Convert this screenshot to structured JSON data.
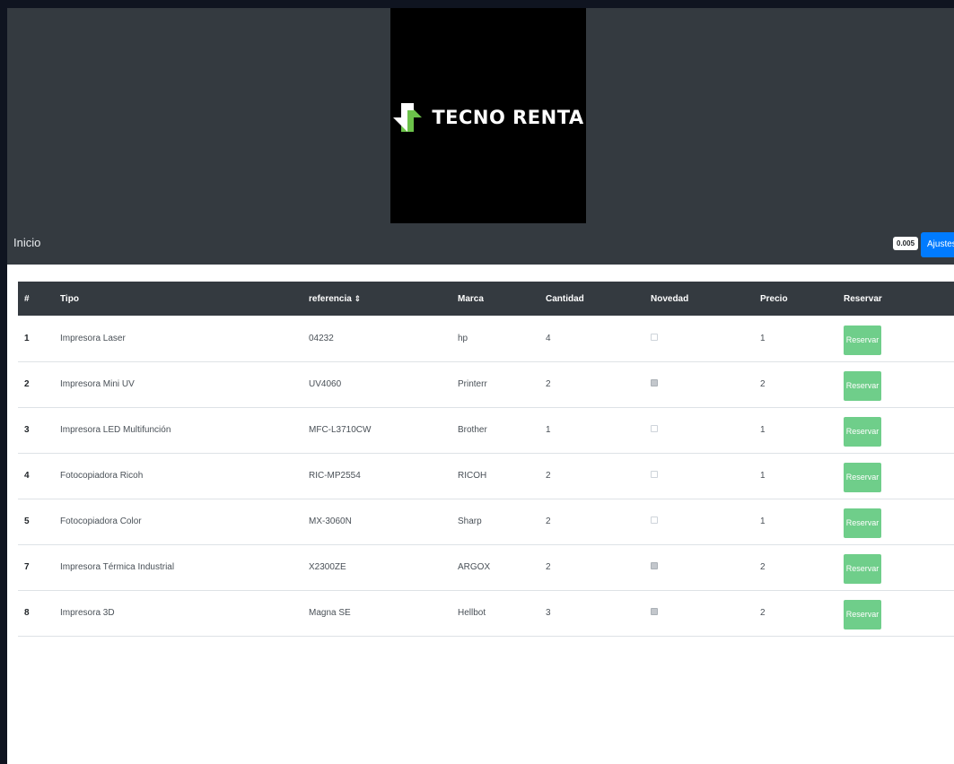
{
  "brand": {
    "name": "TECNO RENTA",
    "logo_icon": "tecno-renta-arrows-icon"
  },
  "nav": {
    "home_label": "Inicio",
    "version": "0.005",
    "settings_label": "Ajustes"
  },
  "table": {
    "columns": [
      "#",
      "Tipo",
      "referencia",
      "Marca",
      "Cantidad",
      "Novedad",
      "Precio",
      "Reservar"
    ],
    "sort_indicator": "⇕",
    "reserve_label": "Reservar",
    "rows": [
      {
        "id": "1",
        "tipo": "Impresora Laser",
        "referencia": "04232",
        "marca": "hp",
        "cantidad": "4",
        "novedad": false,
        "precio": "1"
      },
      {
        "id": "2",
        "tipo": "Impresora Mini UV",
        "referencia": "UV4060",
        "marca": "Printerr",
        "cantidad": "2",
        "novedad": true,
        "precio": "2"
      },
      {
        "id": "3",
        "tipo": "Impresora LED Multifunción",
        "referencia": "MFC-L3710CW",
        "marca": "Brother",
        "cantidad": "1",
        "novedad": false,
        "precio": "1"
      },
      {
        "id": "4",
        "tipo": "Fotocopiadora Ricoh",
        "referencia": "RIC-MP2554",
        "marca": "RICOH",
        "cantidad": "2",
        "novedad": false,
        "precio": "1"
      },
      {
        "id": "5",
        "tipo": "Fotocopiadora Color",
        "referencia": "MX-3060N",
        "marca": "Sharp",
        "cantidad": "2",
        "novedad": false,
        "precio": "1"
      },
      {
        "id": "7",
        "tipo": "Impresora Térmica Industrial",
        "referencia": "X2300ZE",
        "marca": "ARGOX",
        "cantidad": "2",
        "novedad": true,
        "precio": "2"
      },
      {
        "id": "8",
        "tipo": "Impresora 3D",
        "referencia": "Magna SE",
        "marca": "Hellbot",
        "cantidad": "3",
        "novedad": true,
        "precio": "2"
      }
    ]
  },
  "colors": {
    "header_bg": "#343a40",
    "logo_bg": "#000000",
    "logo_green": "#6cc24a",
    "primary": "#007bff",
    "reserve_button": "#6fce8a"
  }
}
